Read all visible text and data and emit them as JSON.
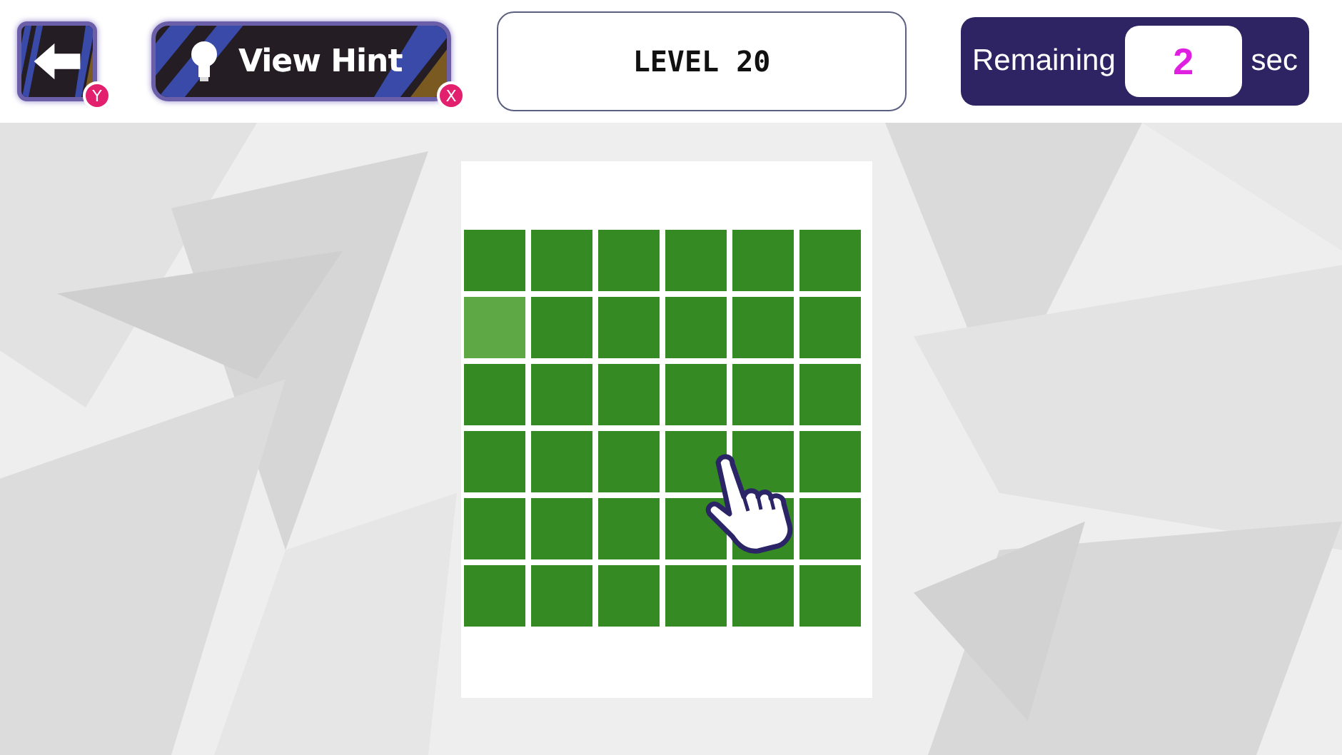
{
  "top_bar": {
    "back_button": {
      "badge": "Y"
    },
    "hint_button": {
      "label": "View Hint",
      "badge": "X"
    },
    "level": "LEVEL 20",
    "timer": {
      "label": "Remaining",
      "value": "2",
      "unit": "sec"
    }
  },
  "grid": {
    "rows": [
      [
        {
          "odd": false
        },
        {
          "odd": false
        },
        {
          "odd": false
        },
        {
          "odd": false
        },
        {
          "odd": false
        },
        {
          "odd": false
        }
      ],
      [
        {
          "odd": true
        },
        {
          "odd": false
        },
        {
          "odd": false
        },
        {
          "odd": false
        },
        {
          "odd": false
        },
        {
          "odd": false
        }
      ],
      [
        {
          "odd": false
        },
        {
          "odd": false
        },
        {
          "odd": false
        },
        {
          "odd": false
        },
        {
          "odd": false
        },
        {
          "odd": false
        }
      ],
      [
        {
          "odd": false
        },
        {
          "odd": false
        },
        {
          "odd": false
        },
        {
          "odd": false
        },
        {
          "odd": false
        },
        {
          "odd": false
        }
      ],
      [
        {
          "odd": false
        },
        {
          "odd": false
        },
        {
          "odd": false
        },
        {
          "odd": false
        },
        {
          "odd": false
        },
        {
          "odd": false
        }
      ],
      [
        {
          "odd": false
        },
        {
          "odd": false
        },
        {
          "odd": false
        },
        {
          "odd": false
        },
        {
          "odd": false
        },
        {
          "odd": false
        }
      ]
    ]
  }
}
